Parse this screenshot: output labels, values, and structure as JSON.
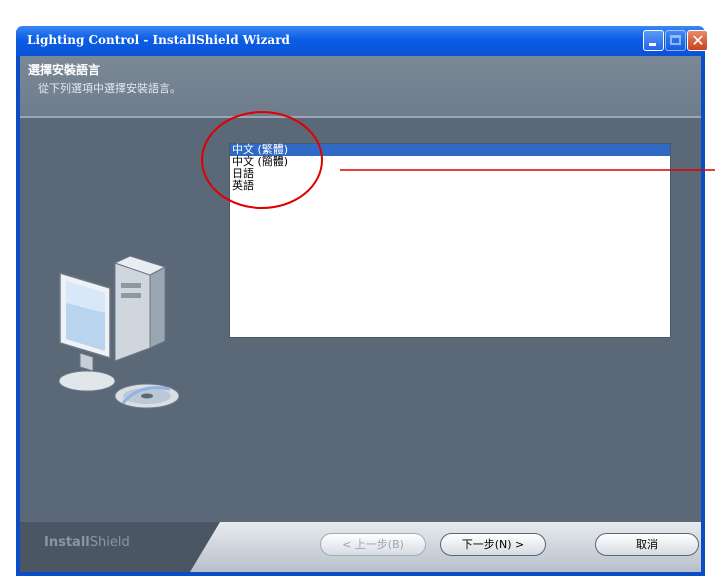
{
  "window": {
    "title": "Lighting Control - InstallShield Wizard"
  },
  "header": {
    "title": "選擇安裝語言",
    "subtitle": "從下列選項中選擇安裝語言。"
  },
  "languages": {
    "items": [
      {
        "label": "中文 (繁體)",
        "selected": true
      },
      {
        "label": "中文 (簡體)",
        "selected": false
      },
      {
        "label": "日語",
        "selected": false
      },
      {
        "label": "英語",
        "selected": false
      }
    ]
  },
  "footer": {
    "brand_bold": "Install",
    "brand_light": "Shield",
    "back_label": "< 上一步(B)",
    "next_label": "下一步(N) >",
    "cancel_label": "取消"
  },
  "colors": {
    "selection": "#316ac5",
    "annotation": "#e00000",
    "titlebar": "#0a5de6"
  }
}
